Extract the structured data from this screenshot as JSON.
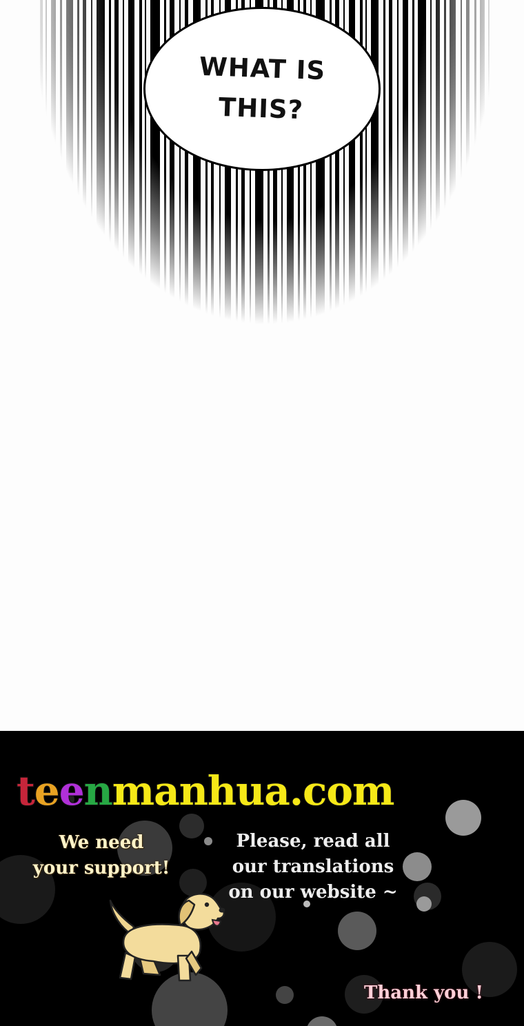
{
  "panel": {
    "speech_bubble": {
      "line1": "WHAT IS",
      "line2": "THIS?"
    }
  },
  "banner": {
    "logo": {
      "parts": [
        "t",
        "e",
        "e",
        "n",
        "manhua.com"
      ],
      "colors": [
        "#c6253a",
        "#e8a222",
        "#b030d8",
        "#27a844",
        "#f6e817"
      ]
    },
    "support": {
      "line1": "We need",
      "line2": "your support!"
    },
    "please": {
      "line1": "Please, read all",
      "line2": "our translations",
      "line3": "on our website ~"
    },
    "thanks": "Thank you !",
    "mascot_icon": "golden-retriever-puppy"
  },
  "colors": {
    "panel_bg": "#fdfdfd",
    "banner_bg": "#000000",
    "support_text": "#fff3c8",
    "thanks_text": "#ffd0d8"
  }
}
